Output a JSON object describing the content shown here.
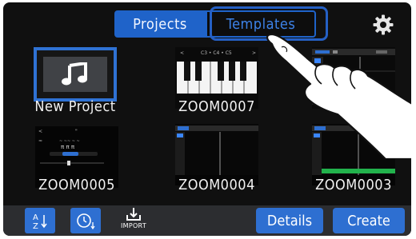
{
  "header": {
    "tabs": [
      {
        "label": "Projects",
        "selected": false
      },
      {
        "label": "Templates",
        "selected": true
      }
    ],
    "settings_icon": "gear-icon"
  },
  "projects": [
    {
      "name": "New Project",
      "thumbnail": "music-note-icon"
    },
    {
      "name": "ZOOM0007",
      "thumbnail": "piano-keyboard"
    },
    {
      "name": "",
      "thumbnail": "tracks"
    },
    {
      "name": "ZOOM0005",
      "thumbnail": "mixer"
    },
    {
      "name": "ZOOM0004",
      "thumbnail": "tracks"
    },
    {
      "name": "ZOOM0003",
      "thumbnail": "tracks"
    }
  ],
  "toolbar": {
    "sort_az_icon": "sort-az-icon",
    "sort_time_icon": "sort-time-icon",
    "import_label": "IMPORT",
    "details_label": "Details",
    "create_label": "Create"
  },
  "colors": {
    "accent": "#1f63c9",
    "background": "#101010",
    "toolbar": "#2c2d30",
    "text": "#f1f1f1"
  }
}
